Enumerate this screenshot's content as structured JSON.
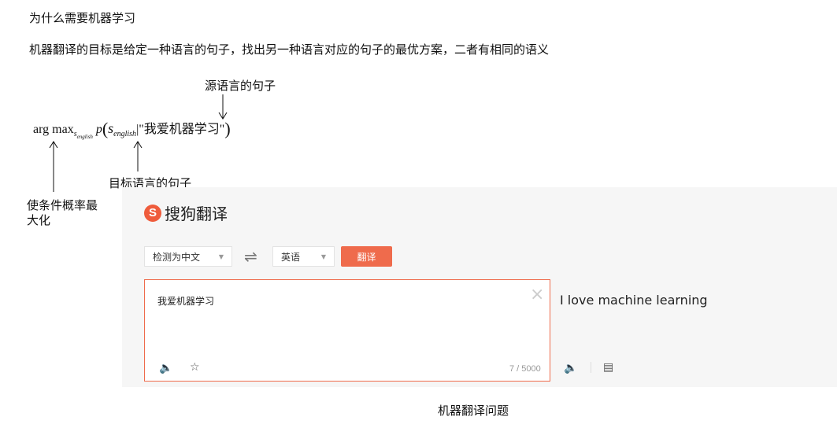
{
  "heading": "为什么需要机器学习",
  "description": "机器翻译的目标是给定一种语言的句子，找出另一种语言对应的句子的最优方案，二者有相同的语义",
  "formula": {
    "argmax": "arg max",
    "argmax_sub": "s",
    "argmax_subsub": "english",
    "p": "p",
    "s": "s",
    "s_sub": "english",
    "given": "|\"我爱机器学习\""
  },
  "annotations": {
    "source_sentence": "源语言的句子",
    "target_sentence": "目标语言的句子",
    "maximize_line1": "使条件概率最",
    "maximize_line2": "大化"
  },
  "translator": {
    "logo_letter": "S",
    "logo_text": "搜狗翻译",
    "source_lang": "检测为中文",
    "swap_icon": "⇌",
    "target_lang": "英语",
    "translate_button": "翻译",
    "input_text": "我爱机器学习",
    "char_count": "7 / 5000",
    "output_text": "I love machine learning",
    "close_icon": "×",
    "speaker_icon": "🔈",
    "star_icon": "☆",
    "copy_icon": "▤",
    "accent_color": "#ef6b4c"
  },
  "caption": "机器翻译问题"
}
